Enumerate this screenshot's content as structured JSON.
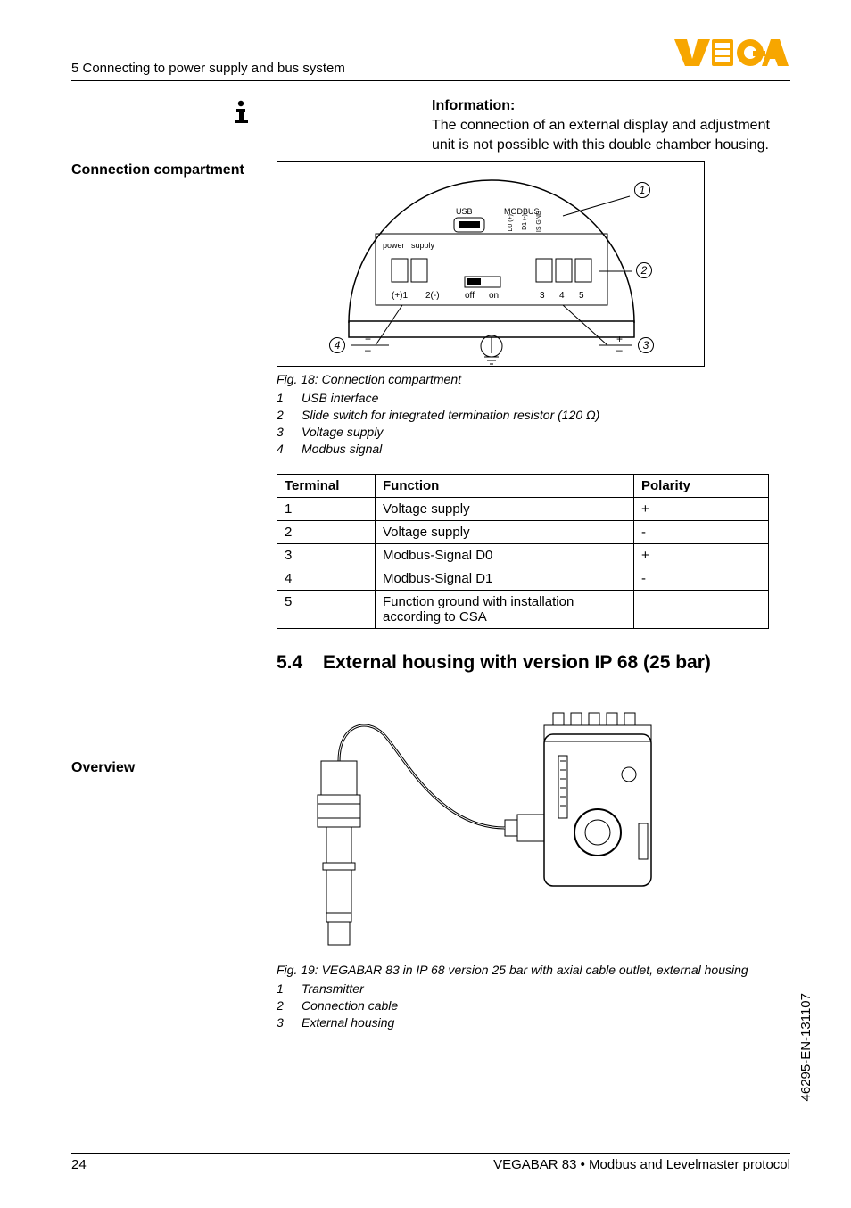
{
  "header": {
    "section_title": "5 Connecting to power supply and bus system",
    "brand": "VEGA"
  },
  "info": {
    "heading": "Information:",
    "body": "The connection of an external display and adjustment unit is not possible with this double chamber housing."
  },
  "sideLabels": {
    "connectionCompartment": "Connection compartment",
    "overview": "Overview"
  },
  "fig18": {
    "labels": {
      "usb": "USB",
      "modbus": "MODBUS",
      "d0": "D0 (+)",
      "d1": "D1 (-)",
      "isgnd": "IS GND",
      "power_supply": "power   supply",
      "plus1": "(+)1",
      "two_minus": "2(-)",
      "off": "off",
      "on": "on",
      "t3": "3",
      "t4": "4",
      "t5": "5"
    },
    "callouts": {
      "c1": "1",
      "c2": "2",
      "c3": "3",
      "c4": "4"
    },
    "caption": "Fig. 18: Connection compartment",
    "items": [
      {
        "n": "1",
        "t": "USB interface"
      },
      {
        "n": "2",
        "t": "Slide switch for integrated termination resistor (120 Ω)"
      },
      {
        "n": "3",
        "t": "Voltage supply"
      },
      {
        "n": "4",
        "t": "Modbus signal"
      }
    ]
  },
  "table": {
    "head": {
      "c1": "Terminal",
      "c2": "Function",
      "c3": "Polarity"
    },
    "rows": [
      {
        "c1": "1",
        "c2": "Voltage supply",
        "c3": "+"
      },
      {
        "c1": "2",
        "c2": "Voltage supply",
        "c3": "-"
      },
      {
        "c1": "3",
        "c2": "Modbus-Signal D0",
        "c3": "+"
      },
      {
        "c1": "4",
        "c2": "Modbus-Signal D1",
        "c3": "-"
      },
      {
        "c1": "5",
        "c2": "Function ground with installation according to CSA",
        "c3": ""
      }
    ]
  },
  "section54": {
    "num": "5.4",
    "title": "External housing with version IP 68 (25 bar)"
  },
  "fig19": {
    "caption": "Fig. 19: VEGABAR 83 in IP 68 version 25 bar with axial cable outlet, external housing",
    "items": [
      {
        "n": "1",
        "t": "Transmitter"
      },
      {
        "n": "2",
        "t": "Connection cable"
      },
      {
        "n": "3",
        "t": "External housing"
      }
    ]
  },
  "footer": {
    "page": "24",
    "product": "VEGABAR 83 • Modbus and Levelmaster protocol"
  },
  "docId": "46295-EN-131107"
}
